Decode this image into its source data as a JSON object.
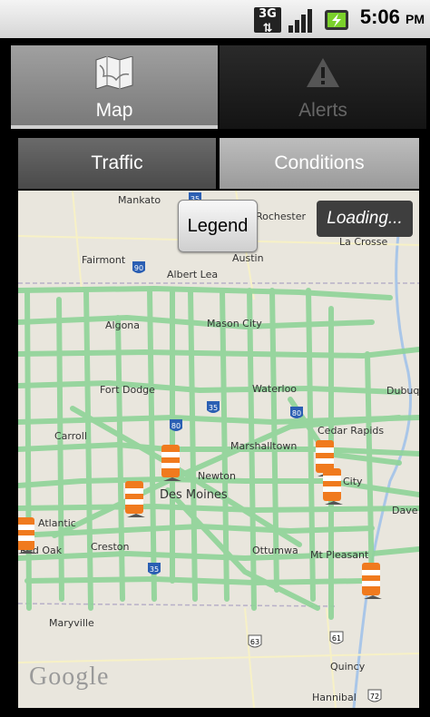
{
  "status_bar": {
    "network": "3G",
    "time": "5:06",
    "ampm": "PM"
  },
  "top_tabs": [
    {
      "label": "Map",
      "icon": "map-icon",
      "active": true
    },
    {
      "label": "Alerts",
      "icon": "warning-icon",
      "active": false
    }
  ],
  "sub_tabs": [
    {
      "label": "Traffic",
      "active": true
    },
    {
      "label": "Conditions",
      "active": false
    }
  ],
  "map": {
    "legend_button": "Legend",
    "loading_text": "Loading...",
    "attribution": "Google",
    "places": [
      "Mankato",
      "Rochester",
      "Fairmont",
      "Austin",
      "La Crosse",
      "Albert Lea",
      "Algona",
      "Mason City",
      "Fort Dodge",
      "Waterloo",
      "Carroll",
      "Marshalltown",
      "Cedar Rapids",
      "Newton",
      "Des Moines",
      "Atlantic",
      "Creston",
      "Ottumwa",
      "Mt Pleasant",
      "Red Oak",
      "Maryville",
      "Quincy",
      "Hannibal",
      "Dave",
      "Dubuq",
      "City"
    ],
    "highway_shields": [
      "35",
      "90",
      "35",
      "80",
      "80",
      "35",
      "63",
      "61",
      "72"
    ]
  },
  "colors": {
    "road": "#8fd498",
    "map_bg": "#e9e6dd",
    "cone": "#f07a1e"
  }
}
